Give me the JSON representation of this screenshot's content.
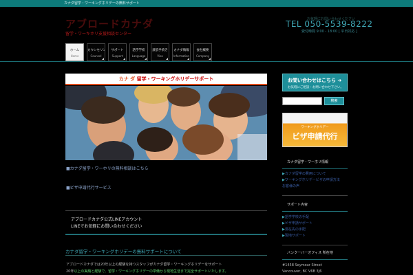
{
  "topbar": {
    "text": "カナダ留学・ワーキングホリデーの無料サポート"
  },
  "header": {
    "logo_main": "アブロードカナダ",
    "logo_sub": "留学・ワーキホリ支援相談センター",
    "tel_caption": "お気軽にお問い合わせください",
    "tel": "TEL 050-5539-8222",
    "hours": "受付時間 9:00 - 18:00 [ 平日対応 ]"
  },
  "nav": [
    {
      "jp": "ホーム",
      "en": "Home",
      "active": true
    },
    {
      "jp": "カウンセリング",
      "en": "Counsel",
      "active": false
    },
    {
      "jp": "サポート",
      "en": "Support",
      "active": false
    },
    {
      "jp": "語学学校",
      "en": "Language",
      "active": false
    },
    {
      "jp": "渡航手続き",
      "en": "Visa",
      "active": false
    },
    {
      "jp": "カナダ情報",
      "en": "Information",
      "active": false
    },
    {
      "jp": "会社概要",
      "en": "Company",
      "active": false
    }
  ],
  "banner": {
    "title_prefix": "カナ ダ ",
    "title_red": "留学・ワーキングホリデーサポート"
  },
  "main": {
    "link1": "■カナダ留学・ワーホリの無料相談はこちら",
    "link2": "■ビザ申請代行サービス",
    "line_box_1": "アブロードカナダ公式LINEアカウント",
    "line_box_2": "LINEでお気軽にお問い合わせください",
    "section_heading": "カナダ留学・ワーキングホリデーの無料サポートについて",
    "body_1": "アブロードカナダでは20年以上の経験を持つスタッフがカナダ留学・ワーキングホリデーをサポート",
    "body_2_prefix": "20年",
    "body_2_highlight": "以上の実績と経験で、留学・ワーキングホリデーの準備から現地生活まで完全サポートいたします。"
  },
  "sidebar": {
    "contact_line1": "お問い合わせはこちら ➜",
    "contact_line2": "お気軽にご相談・お問い合わせ下さい。",
    "search_placeholder": "",
    "search_button": "検索",
    "visa_small": "ワーキングホリデー",
    "visa_big": "ビザ申請代行",
    "heading1": "カナダ留学・ワーホリ情報",
    "links1": [
      "カナダ留学の費用について",
      "ワーキングホリデービザの申請方法",
      "お客様の声"
    ],
    "heading2": "サポート内容",
    "links2": [
      "語学学校の手配",
      "ビザ申請サポート",
      "滞在先の手配",
      "現地サポート"
    ],
    "heading3": "バンクーバーオフィス 所在地",
    "address1": "#1458 Seymour Street",
    "address2": "Vancouver, BC V6B 3J6"
  }
}
